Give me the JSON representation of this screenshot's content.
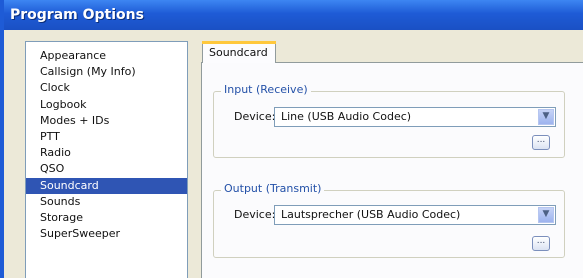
{
  "window": {
    "title": "Program Options"
  },
  "sidebar": {
    "items": [
      {
        "label": "Appearance",
        "selected": false
      },
      {
        "label": "Callsign (My Info)",
        "selected": false
      },
      {
        "label": "Clock",
        "selected": false
      },
      {
        "label": "Logbook",
        "selected": false
      },
      {
        "label": "Modes + IDs",
        "selected": false
      },
      {
        "label": "PTT",
        "selected": false
      },
      {
        "label": "Radio",
        "selected": false
      },
      {
        "label": "QSO",
        "selected": false
      },
      {
        "label": "Soundcard",
        "selected": true
      },
      {
        "label": "Sounds",
        "selected": false
      },
      {
        "label": "Storage",
        "selected": false
      },
      {
        "label": "SuperSweeper",
        "selected": false
      }
    ]
  },
  "tabs": [
    {
      "label": "Soundcard",
      "active": true
    }
  ],
  "input_group": {
    "legend": "Input (Receive)",
    "device_label": "Device:",
    "device_value": "Line (USB Audio Codec)"
  },
  "output_group": {
    "legend": "Output (Transmit)",
    "device_label": "Device:",
    "device_value": "Lautsprecher (USB Audio Codec)"
  },
  "icons": {
    "dropdown": "chevron-down-icon",
    "browse": "ellipsis-icon"
  },
  "colors": {
    "titlebar": "#1e5bd6",
    "selection": "#2f55b4",
    "tab_accent": "#ffc83c",
    "group_legend": "#2451a8"
  }
}
